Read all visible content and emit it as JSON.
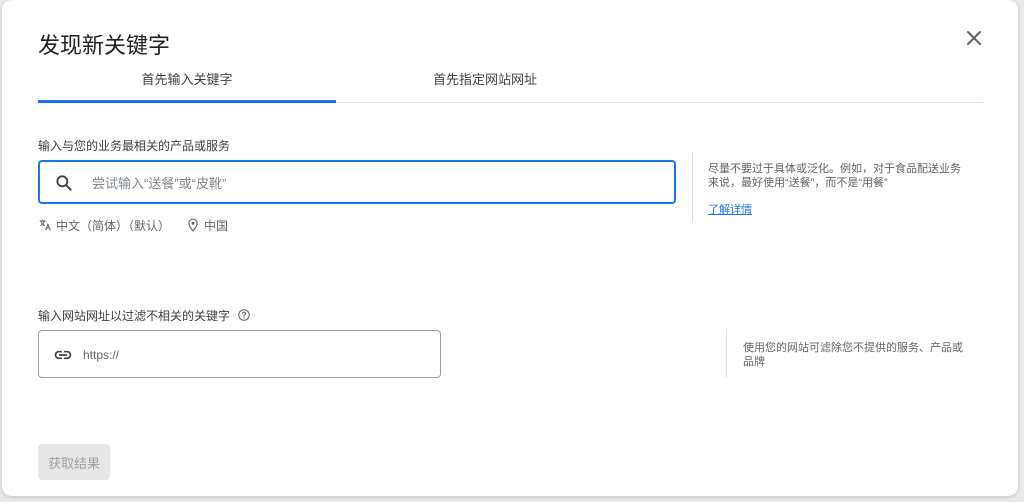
{
  "dialog": {
    "title": "发现新关键字",
    "tabs": [
      {
        "label": "首先输入关键字",
        "active": true
      },
      {
        "label": "首先指定网站网址",
        "active": false
      }
    ]
  },
  "keyword_section": {
    "label": "输入与您的业务最相关的产品或服务",
    "placeholder": "尝试输入“送餐”或“皮靴”",
    "language": "中文（简体）（默认）",
    "location": "中国",
    "hint": "尽量不要过于具体或泛化。例如，对于食品配送业务来说，最好使用“送餐”，而不是“用餐”",
    "learn_more": "了解详情"
  },
  "url_section": {
    "label": "输入网站网址以过滤不相关的关键字",
    "placeholder": "https://",
    "hint": "使用您的网站可滤除您不提供的服务、产品或品牌"
  },
  "actions": {
    "submit_label": "获取结果"
  },
  "icons": {
    "close": "close-icon",
    "search": "search-icon",
    "translate": "translate-icon",
    "location": "location-pin-icon",
    "help": "help-icon",
    "link": "link-icon"
  },
  "colors": {
    "accent": "#1a73e8",
    "disabled_button_bg": "#e6e6e6",
    "disabled_button_text": "#a0a0a0"
  }
}
